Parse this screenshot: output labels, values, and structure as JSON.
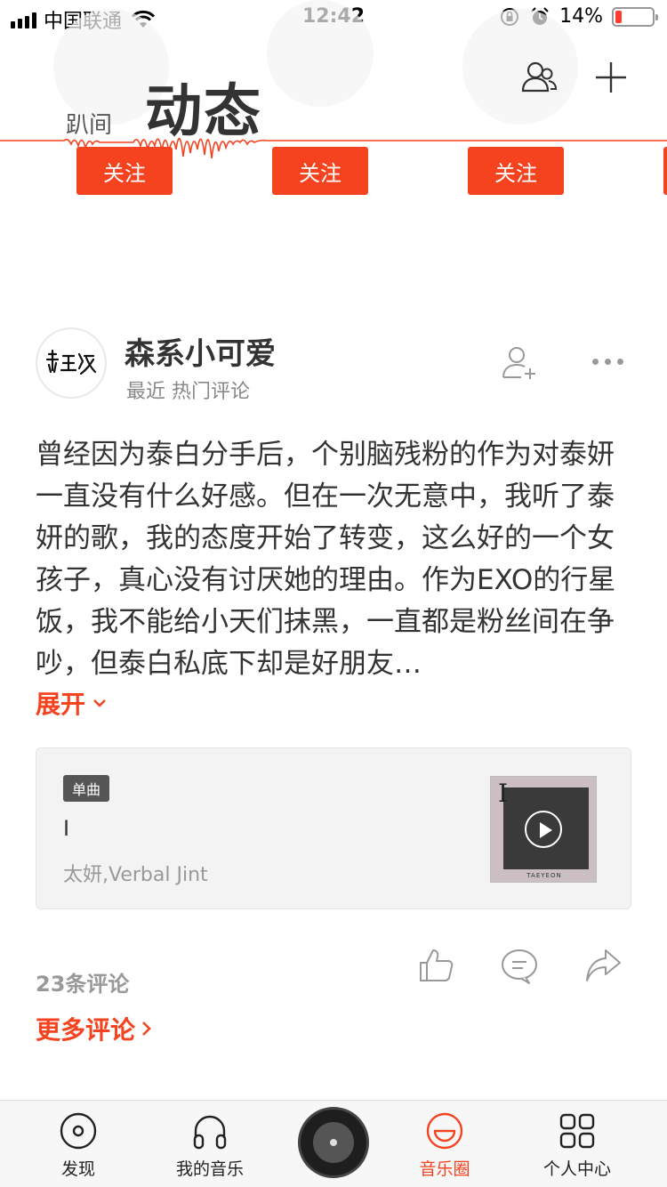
{
  "status_bar": {
    "carrier": "中国联通",
    "time": "12:42",
    "battery": "14%",
    "battery_level": 0.14
  },
  "header": {
    "tab_secondary": "趴间",
    "tab_primary": "动态",
    "friends_icon": "friends-icon",
    "add_icon": "plus-icon"
  },
  "recommend": {
    "follow_labels": [
      "关注",
      "关注",
      "关注"
    ]
  },
  "post": {
    "username": "森系小可爱",
    "subline": "最近 热门评论",
    "avatar_icon": "calligraphy-avatar",
    "text": "曾经因为泰白分手后，个别脑残粉的作为对泰妍一直没有什么好感。但在一次无意中，我听了泰妍的歌，我的态度开始了转变，这么好的一个女孩子，真心没有讨厌她的理由。作为EXO的行星饭，我不能给小天们抹黑，一直都是粉丝间在争吵，但泰白私底下却是好朋友…",
    "expand": "展开",
    "song": {
      "badge": "单曲",
      "title": "I",
      "artist": "太妍,Verbal Jint",
      "cover_letter": "I",
      "cover_caption": "TAEYEON"
    },
    "comment_count": "23条评论",
    "more_comments": "更多评论"
  },
  "tabbar": {
    "tabs": [
      {
        "label": "发现",
        "icon": "disc-icon"
      },
      {
        "label": "我的音乐",
        "icon": "headphones-icon"
      },
      {
        "label": "音乐圈",
        "icon": "music-circle-icon"
      },
      {
        "label": "个人中心",
        "icon": "grid-icon"
      }
    ],
    "active_tab": "音乐圈"
  },
  "colors": {
    "accent": "#f5421f",
    "text": "#333333",
    "muted": "#999999"
  }
}
